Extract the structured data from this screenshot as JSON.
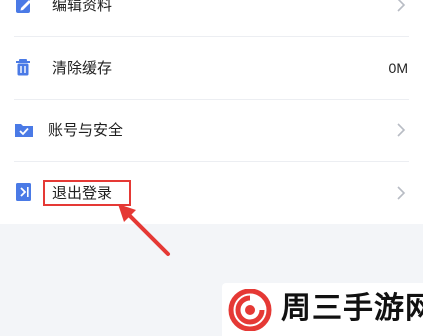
{
  "settings": {
    "items": [
      {
        "label": "编辑资料",
        "icon": "edit-icon"
      },
      {
        "label": "清除缓存",
        "icon": "trash-icon",
        "value": "0M"
      },
      {
        "label": "账号与安全",
        "icon": "folder-check-icon"
      },
      {
        "label": "退出登录",
        "icon": "logout-icon"
      }
    ]
  },
  "colors": {
    "accent": "#4a7ae6",
    "annotation": "#e53935",
    "background": "#f3f5f8",
    "watermark_red": "#e53935"
  },
  "watermark": {
    "text": "周三手游网"
  }
}
